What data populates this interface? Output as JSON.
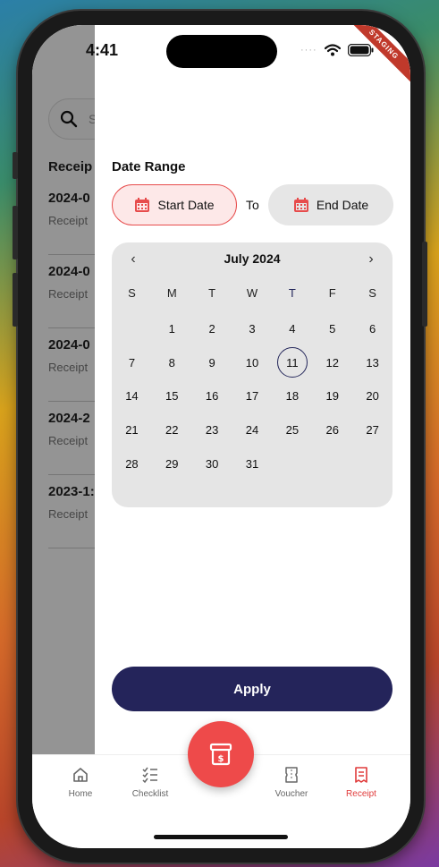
{
  "status_bar": {
    "time": "4:41"
  },
  "ribbon": {
    "label": "STAGING"
  },
  "background_list": {
    "search_placeholder": "S",
    "section_title": "Receip",
    "items": [
      {
        "date": "2024-0",
        "subtitle": "Receipt"
      },
      {
        "date": "2024-0",
        "subtitle": "Receipt"
      },
      {
        "date": "2024-0",
        "subtitle": "Receipt"
      },
      {
        "date": "2024-2",
        "subtitle": "Receipt"
      },
      {
        "date": "2023-1:",
        "subtitle": "Receipt"
      }
    ]
  },
  "date_range": {
    "title": "Date Range",
    "start_label": "Start Date",
    "to_label": "To",
    "end_label": "End Date"
  },
  "calendar": {
    "month": "July 2024",
    "prev": "‹",
    "next": "›",
    "weekdays": [
      "S",
      "M",
      "T",
      "W",
      "T",
      "F",
      "S"
    ],
    "weeks": [
      [
        "",
        "1",
        "2",
        "3",
        "4",
        "5",
        "6"
      ],
      [
        "7",
        "8",
        "9",
        "10",
        "11",
        "12",
        "13"
      ],
      [
        "14",
        "15",
        "16",
        "17",
        "18",
        "19",
        "20"
      ],
      [
        "21",
        "22",
        "23",
        "24",
        "25",
        "26",
        "27"
      ],
      [
        "28",
        "29",
        "30",
        "31",
        "",
        "",
        ""
      ]
    ],
    "today": "11"
  },
  "apply_label": "Apply",
  "tabbar": {
    "home": "Home",
    "checklist": "Checklist",
    "voucher": "Voucher",
    "receipt": "Receipt"
  },
  "colors": {
    "accent_red": "#ee4a4a",
    "navy": "#24245a"
  }
}
